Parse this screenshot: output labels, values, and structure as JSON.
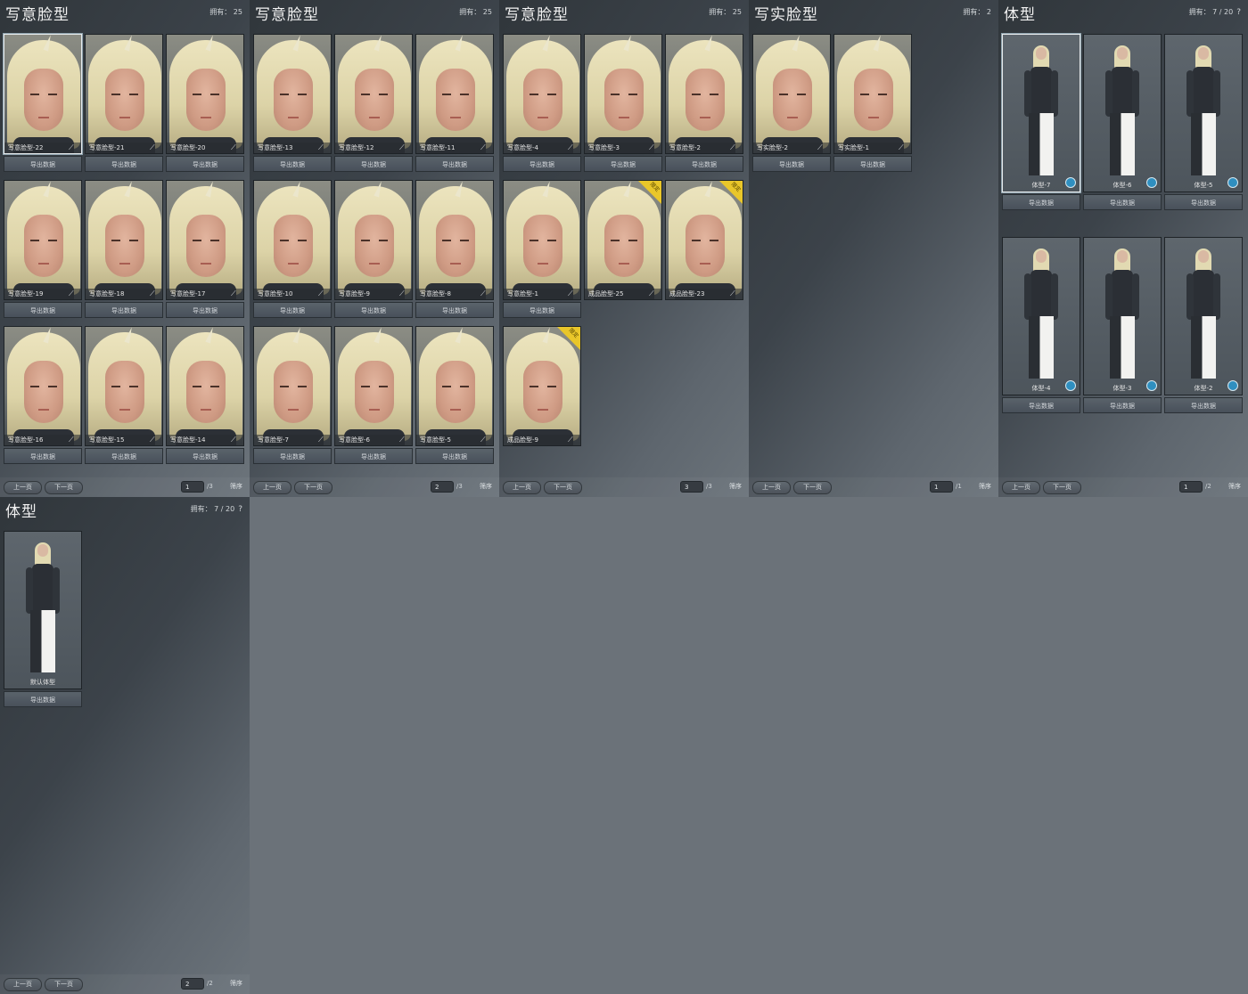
{
  "panels": [
    {
      "title": "写意脸型",
      "owned": "拥有： 25",
      "help": "",
      "type": "face",
      "cols": 3,
      "cards": [
        {
          "name": "写意脸型-22",
          "button": "导出数据",
          "selected": true
        },
        {
          "name": "写意脸型-21",
          "button": "导出数据"
        },
        {
          "name": "写意脸型-20",
          "button": "导出数据"
        },
        {
          "name": "写意脸型-19",
          "button": "导出数据"
        },
        {
          "name": "写意脸型-18",
          "button": "导出数据"
        },
        {
          "name": "写意脸型-17",
          "button": "导出数据"
        },
        {
          "name": "写意脸型-16",
          "button": "导出数据"
        },
        {
          "name": "写意脸型-15",
          "button": "导出数据"
        },
        {
          "name": "写意脸型-14",
          "button": "导出数据"
        }
      ],
      "pager": {
        "prev": "上一页",
        "next": "下一页",
        "page": "1",
        "total": "/3",
        "sort": "筛序"
      }
    },
    {
      "title": "写意脸型",
      "owned": "拥有： 25",
      "help": "",
      "type": "face",
      "cols": 3,
      "cards": [
        {
          "name": "写意脸型-13",
          "button": "导出数据"
        },
        {
          "name": "写意脸型-12",
          "button": "导出数据"
        },
        {
          "name": "写意脸型-11",
          "button": "导出数据"
        },
        {
          "name": "写意脸型-10",
          "button": "导出数据"
        },
        {
          "name": "写意脸型-9",
          "button": "导出数据"
        },
        {
          "name": "写意脸型-8",
          "button": "导出数据"
        },
        {
          "name": "写意脸型-7",
          "button": "导出数据"
        },
        {
          "name": "写意脸型-6",
          "button": "导出数据"
        },
        {
          "name": "写意脸型-5",
          "button": "导出数据"
        }
      ],
      "pager": {
        "prev": "上一页",
        "next": "下一页",
        "page": "2",
        "total": "/3",
        "sort": "筛序"
      }
    },
    {
      "title": "写意脸型",
      "owned": "拥有： 25",
      "help": "",
      "type": "face",
      "cols": 3,
      "cards": [
        {
          "name": "写意脸型-4",
          "button": "导出数据"
        },
        {
          "name": "写意脸型-3",
          "button": "导出数据"
        },
        {
          "name": "写意脸型-2",
          "button": "导出数据"
        },
        {
          "name": "写意脸型-1",
          "button": "导出数据"
        },
        {
          "name": "成品脸型-25",
          "button": "",
          "badge": "限定"
        },
        {
          "name": "成品脸型-23",
          "button": "",
          "badge": "限定"
        },
        {
          "name": "成品脸型-9",
          "button": "",
          "badge": "限定"
        }
      ],
      "pager": {
        "prev": "上一页",
        "next": "下一页",
        "page": "3",
        "total": "/3",
        "sort": "筛序"
      }
    },
    {
      "title": "写实脸型",
      "owned": "拥有： 2",
      "help": "",
      "type": "face",
      "cols": 3,
      "cards": [
        {
          "name": "写实脸型-2",
          "button": "导出数据"
        },
        {
          "name": "写实脸型-1",
          "button": "导出数据"
        }
      ],
      "pager": {
        "prev": "上一页",
        "next": "下一页",
        "page": "1",
        "total": "/1",
        "sort": "筛序"
      }
    },
    {
      "title": "体型",
      "owned": "拥有： 7 / 20",
      "help": "?",
      "type": "body",
      "cols": 3,
      "cards": [
        {
          "name": "体型-7",
          "button": "导出数据",
          "selected": true
        },
        {
          "name": "体型-6",
          "button": "导出数据"
        },
        {
          "name": "体型-5",
          "button": "导出数据"
        },
        {
          "name": "体型-4",
          "button": "导出数据"
        },
        {
          "name": "体型-3",
          "button": "导出数据"
        },
        {
          "name": "体型-2",
          "button": "导出数据"
        }
      ],
      "pager": {
        "prev": "上一页",
        "next": "下一页",
        "page": "1",
        "total": "/2",
        "sort": "筛序"
      }
    },
    {
      "title": "体型",
      "owned": "拥有： 7 / 20",
      "help": "?",
      "type": "body",
      "cols": 3,
      "cards": [
        {
          "name": "默认体型",
          "button": "导出数据",
          "noicon": true
        }
      ],
      "pager": {
        "prev": "上一页",
        "next": "下一页",
        "page": "2",
        "total": "/2",
        "sort": "筛序"
      }
    }
  ],
  "colors": {
    "badge": "#e9c62a",
    "body_icon": "#2f8fc0",
    "background": "#6b7279"
  }
}
